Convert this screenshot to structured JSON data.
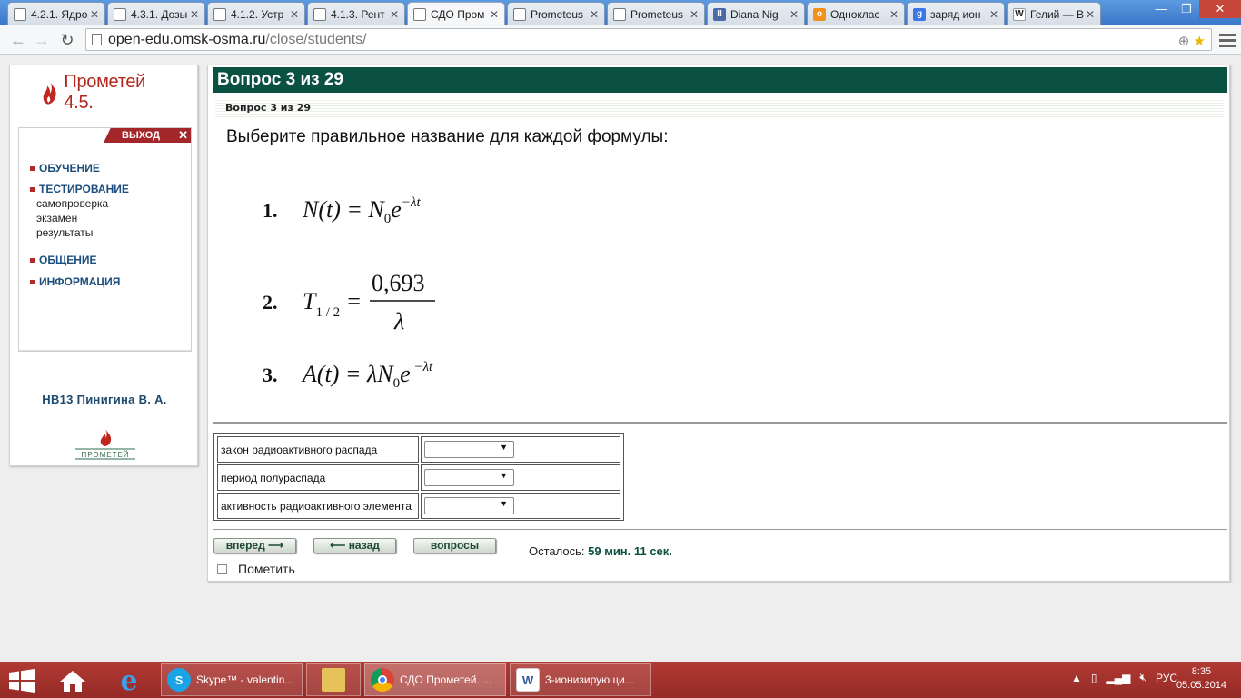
{
  "browser": {
    "tabs": [
      {
        "title": "4.2.1. Ядро",
        "icon": "document-icon",
        "active": false
      },
      {
        "title": "4.3.1. Дозы",
        "icon": "document-icon",
        "active": false
      },
      {
        "title": "4.1.2. Устр",
        "icon": "document-icon",
        "active": false
      },
      {
        "title": "4.1.3. Рент",
        "icon": "document-icon",
        "active": false
      },
      {
        "title": "СДО Пром",
        "icon": "document-icon",
        "active": true
      },
      {
        "title": "Prometeus",
        "icon": "document-icon",
        "active": false
      },
      {
        "title": "Prometeus",
        "icon": "document-icon",
        "active": false
      },
      {
        "title": "Diana Nig",
        "icon": "pause-icon",
        "active": false
      },
      {
        "title": "Одноклас",
        "icon": "odnoklassniki-icon",
        "active": false
      },
      {
        "title": "заряд ион",
        "icon": "google-icon",
        "active": false
      },
      {
        "title": "Гелий — В",
        "icon": "wikipedia-icon",
        "active": false
      }
    ],
    "url_host": "open-edu.omsk-osma.ru",
    "url_path": "/close/students/"
  },
  "sidebar": {
    "logo_text": "Прометей 4.5.",
    "exit_label": "ВЫХОД",
    "menu": {
      "learning": "ОБУЧЕНИЕ",
      "testing": "ТЕСТИРОВАНИЕ",
      "testing_sub": [
        "самопроверка",
        "экзамен",
        "результаты"
      ],
      "communication": "ОБЩЕНИЕ",
      "information": "ИНФОРМАЦИЯ"
    },
    "user": "НВ13 Пинигина В. А.",
    "bottom_logo_text": "ПРОМЕТЕЙ"
  },
  "question": {
    "header": "Вопрос 3 из 29",
    "subheader": "Вопрос 3 из 29",
    "text": "Выберите правильное название для каждой формулы:",
    "formulas": [
      {
        "number": "1.",
        "formula": "N(t) = N0 e^(-λt)"
      },
      {
        "number": "2.",
        "formula": "T1/2 = 0,693 / λ"
      },
      {
        "number": "3.",
        "formula": "A(t) = λ N0 e^(-λt)"
      }
    ],
    "matches": [
      {
        "label": "закон радиоактивного распада",
        "selected": ""
      },
      {
        "label": "период полураспада",
        "selected": ""
      },
      {
        "label": "активность радиоактивного элемента",
        "selected": ""
      }
    ]
  },
  "controls": {
    "forward": "вперед",
    "back": "назад",
    "questions": "вопросы",
    "remaining_label": "Осталось:",
    "remaining_value": "59 мин. 11 сек.",
    "mark_label": "Пометить"
  },
  "taskbar": {
    "tasks": [
      {
        "label": "Skype™ - valentin...",
        "icon": "skype-icon"
      },
      {
        "label": "",
        "icon": "folder-icon"
      },
      {
        "label": "СДО Прометей. ...",
        "icon": "chrome-icon"
      },
      {
        "label": "3-ионизирующи...",
        "icon": "word-icon"
      }
    ],
    "language": "РУС",
    "time": "8:35",
    "date": "05.05.2014"
  },
  "colors": {
    "header_green": "#0b5142",
    "brand_red": "#b3261e",
    "menu_blue": "#1b4e7e",
    "taskbar": "#a83232"
  }
}
